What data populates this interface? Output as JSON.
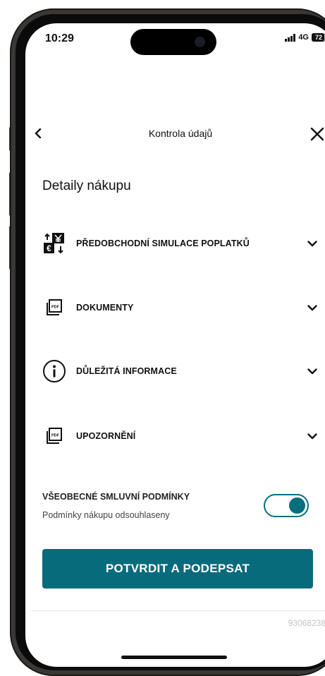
{
  "status_bar": {
    "time": "10:29",
    "network": "4G",
    "battery": "72"
  },
  "header": {
    "title": "Kontrola údajů"
  },
  "section": {
    "title": "Detaily nákupu"
  },
  "accordion": [
    {
      "label": "PŘEDOBCHODNÍ SIMULACE POPLATKŮ",
      "icon": "currency-exchange-icon"
    },
    {
      "label": "DOKUMENTY",
      "icon": "pdf-document-icon"
    },
    {
      "label": "DŮLEŽITÁ INFORMACE",
      "icon": "info-icon"
    },
    {
      "label": "UPOZORNĚNÍ",
      "icon": "pdf-document-icon"
    }
  ],
  "terms": {
    "title": "VŠEOBECNÉ SMLUVNÍ PODMÍNKY",
    "subtitle": "Podmínky nákupu odsouhlaseny",
    "toggle_on": true
  },
  "cta": {
    "label": "POTVRDIT A PODEPSAT"
  },
  "footer": {
    "reference": "93068238"
  },
  "colors": {
    "accent": "#086b7b",
    "text": "#111111",
    "muted": "#c3c3c3"
  }
}
